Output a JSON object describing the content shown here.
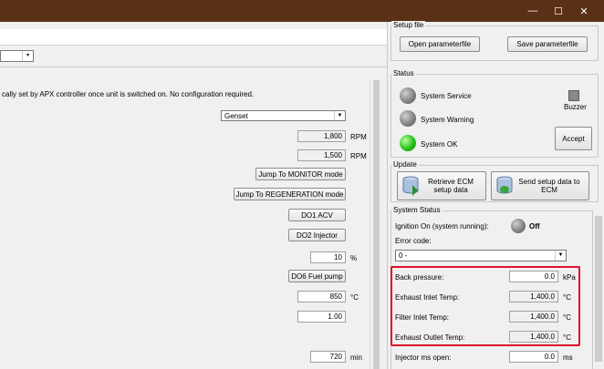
{
  "window": {
    "minimize_glyph": "—",
    "maximize_glyph": "☐",
    "close_glyph": "✕"
  },
  "left_panel": {
    "top_dropdown_arrow": "▾",
    "info_text": "cally set by APX controller once unit is switched on. No configuration required.",
    "mode_select": "Genset",
    "rpm_1_value": "1,800",
    "rpm_1_unit": "RPM",
    "rpm_2_value": "1,500",
    "rpm_2_unit": "RPM",
    "jump_monitor": "Jump To MONITOR mode",
    "jump_regeneration": "Jump To REGENERATION mode",
    "do1": "DO1 ACV",
    "do2": "DO2 Injector",
    "percent_value": "10",
    "percent_unit": "%",
    "do6": "DO6 Fuel pump",
    "temp_value": "850",
    "temp_unit": "°C",
    "factor_value": "1.00",
    "min_value": "720",
    "min_unit": "min"
  },
  "setup_file": {
    "title": "Setup file",
    "open_label": "Open parameterfile",
    "save_label": "Save parameterfile"
  },
  "status": {
    "title": "Status",
    "system_service": "System Service",
    "system_warning": "System Warning",
    "system_ok": "System OK",
    "buzzer": "Buzzer",
    "accept": "Accept"
  },
  "update": {
    "title": "Update",
    "retrieve_label": "Retrieve ECM setup data",
    "send_label": "Send setup data to ECM"
  },
  "system_status": {
    "title": "System Status",
    "ignition_label": "Ignition On (system running):",
    "ignition_state": "Off",
    "error_code_label": "Error code:",
    "error_code_value": "0 -",
    "back_pressure_label": "Back pressure:",
    "back_pressure_value": "0.0",
    "back_pressure_unit": "kPa",
    "exhaust_inlet_label": "Exhaust Inlet Temp:",
    "exhaust_inlet_value": "1,400.0",
    "exhaust_inlet_unit": "°C",
    "filter_inlet_label": "Filter Inlet Temp:",
    "filter_inlet_value": "1,400.0",
    "filter_inlet_unit": "°C",
    "exhaust_outlet_label": "Exhaust Outlet Temp:",
    "exhaust_outlet_value": "1,400.0",
    "exhaust_outlet_unit": "°C",
    "injector_label": "Injector ms open:",
    "injector_value": "0.0",
    "injector_unit": "ms"
  },
  "colors": {
    "titlebar": "#5a3017",
    "highlight": "#e0102a",
    "led_on": "#27c11b"
  }
}
